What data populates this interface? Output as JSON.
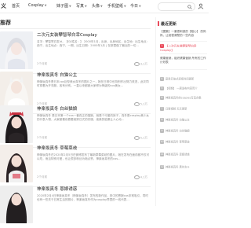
{
  "nav": {
    "logo": "义",
    "items": [
      {
        "label": "首页",
        "caret": false
      },
      {
        "label": "Cosplay",
        "caret": true
      },
      {
        "label": "妹子图",
        "caret": true
      },
      {
        "label": "写真",
        "caret": true
      },
      {
        "label": "头像",
        "caret": true
      },
      {
        "label": "手机壁纸",
        "caret": true
      },
      {
        "label": "今日",
        "caret": true
      }
    ]
  },
  "section": {
    "title": "推荐"
  },
  "posts": [
    {
      "title": "二次元女装攀智琴白幸Cosplay",
      "excerpt": "名字：攀智琴白发Id，【ID/姓名：】 2000年1月，出身，出身地区，出生地：出生地点：西宁，出生地点：西宁，一期，出生日期：2000年1月 | 在那里做了最近的一切...",
      "date": "2个月前",
      "views": "3,1万"
    },
    {
      "title": "神楽坂真冬 白猫公主",
      "excerpt": "神楽坂真冬是日本cos巨型美女真冬的图片之一，她在日常中也特别作出努力改进，此次同时穿着为开衣服，各有分别。一直以来都被大家称为神级的cos美女...",
      "date": "2个月前",
      "views": "5,1万"
    },
    {
      "title": "神楽坂真冬 白丝猫娘",
      "excerpt": "神楽坂真冬 是日本第一个cos一套真正的猫娘，她是个可爱的妹子，真冬是cosplay美少女的代表人物，大家都喜欢看着她穿日式的衣服，绝美的脸蛋让人心动...",
      "date": "2个月前",
      "views": "5,1万"
    },
    {
      "title": "神楽坂真冬 草莓菜歧",
      "excerpt": "神楽坂真冬在2020年2月5日在微博发布了最新草莓菜歧的图片，她在发布在面前都不仅可以吃，而且特别可爱，也让很多粉丝为她点赞，神楽坂真冬的cos...",
      "date": "2个月前",
      "views": "4,1万"
    },
    {
      "title": "神楽坂真冬 恩娘诱惑",
      "excerpt": "2020年2月4日神楽坂真冬（神楽坂真冬）发布的新作品，其中的恩娘cos非常吸引，同时也有一些关于日常生活的照片，神楽坂真冬作为cosplay界里的一线代表...",
      "date": "2个月前",
      "views": "4,1万"
    }
  ],
  "sidebar": {
    "title": "最近更新",
    "items": [
      {
        "text": "【图集】一套很刺激的【粗心】 的妈妈，让她很清楚的一些内容",
        "num": null,
        "red": false,
        "small": false
      },
      {
        "text": "【二次元女装攀智琴白幸Cosplay】",
        "num": "1",
        "red": true,
        "small": false
      },
      {
        "text": "健康营销，组织健康营销 所有的工作计划表",
        "num": null,
        "red": false,
        "small": false
      },
      {
        "text": "夏季开放式连续时间更新",
        "num": "4",
        "red": false,
        "small": true
      },
      {
        "text": "【视频】 一周发布内容简介",
        "num": "5",
        "red": false,
        "small": true
      },
      {
        "text": "神楽坂真冬的cosplay写真合集",
        "num": "6",
        "red": false,
        "small": true
      },
      {
        "text": "日更视频 天天更新",
        "num": "7",
        "red": false,
        "small": true
      },
      {
        "text": "神楽坂真冬 白猫公主",
        "num": "8",
        "red": false,
        "small": true
      },
      {
        "text": "神楽坂真冬 白丝猫娘",
        "num": "9",
        "red": false,
        "small": true
      },
      {
        "text": "神楽坂真冬 草莓菜歧",
        "num": "10",
        "red": false,
        "small": true
      },
      {
        "text": "神楽坂真冬 恩娘诱惑",
        "num": "11",
        "red": false,
        "small": true
      },
      {
        "text": "神楽坂真冬 黑丝女仆",
        "num": "12",
        "red": false,
        "small": true
      }
    ]
  },
  "colors": {
    "accent": "#e94a5a"
  }
}
